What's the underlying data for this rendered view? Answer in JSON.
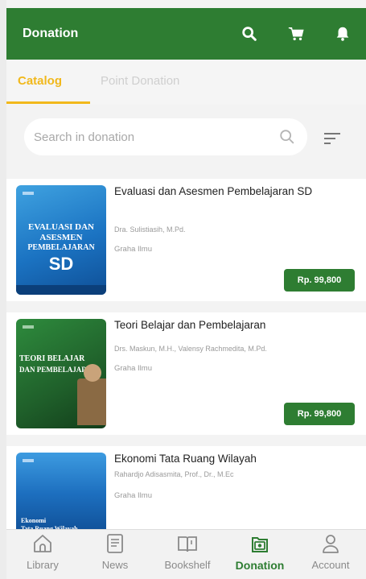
{
  "header": {
    "title": "Donation",
    "icons": [
      "search-icon",
      "cart-icon",
      "bell-icon"
    ]
  },
  "tabs": [
    {
      "label": "Catalog",
      "active": true
    },
    {
      "label": "Point Donation",
      "active": false
    }
  ],
  "search": {
    "placeholder": "Search in donation"
  },
  "books": [
    {
      "title": "Evaluasi dan Asesmen Pembelajaran SD",
      "author": "Dra. Sulistiasih, M.Pd.",
      "publisher": "Graha Ilmu",
      "price": "Rp. 99,800",
      "cover_text": [
        "EVALUASI DAN",
        "ASESMEN",
        "PEMBELAJARAN",
        "SD"
      ]
    },
    {
      "title": "Teori Belajar dan Pembelajaran",
      "author": "Drs. Maskun, M.H., Valensy Rachmedita, M.Pd.",
      "publisher": "Graha Ilmu",
      "price": "Rp. 99,800",
      "cover_text": [
        "TEORI BELAJAR",
        "DAN PEMBELAJARAN"
      ]
    },
    {
      "title": "Ekonomi Tata Ruang Wilayah",
      "author": "Rahardjo Adisasmita, Prof., Dr., M.Ec",
      "publisher": "Graha Ilmu",
      "cover_text": [
        "Ekonomi",
        "Tata Ruang Wilayah"
      ]
    }
  ],
  "nav": [
    {
      "label": "Library",
      "icon": "home-icon"
    },
    {
      "label": "News",
      "icon": "news-icon"
    },
    {
      "label": "Bookshelf",
      "icon": "book-icon"
    },
    {
      "label": "Donation",
      "icon": "donation-icon",
      "active": true
    },
    {
      "label": "Account",
      "icon": "person-icon"
    }
  ],
  "colors": {
    "primary": "#2e7d32",
    "accent": "#f1b81b"
  }
}
